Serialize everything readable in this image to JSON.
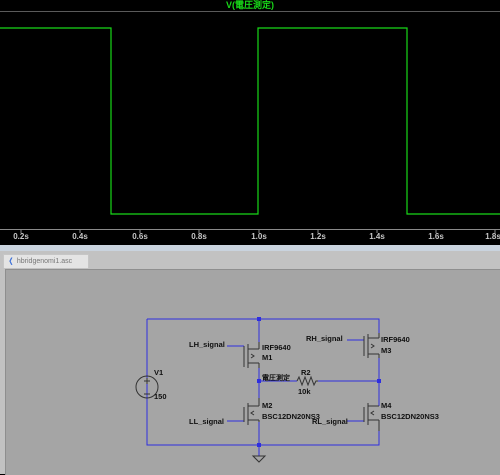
{
  "plot": {
    "trace_name": "V(電圧測定)",
    "trace_color": "#18d818",
    "background": "#000000",
    "x_ticks": [
      "0.2s",
      "0.4s",
      "0.6s",
      "0.8s",
      "1.0s",
      "1.2s",
      "1.4s",
      "1.6s",
      "1.8s"
    ]
  },
  "schematic": {
    "tab_title": "hbridgenomi1.asc",
    "wire_color": "#2e2ee0",
    "labels": {
      "lh_signal": "LH_signal",
      "ll_signal": "LL_signal",
      "rh_signal": "RH_signal",
      "rl_signal": "RL_signal",
      "m1_model": "IRF9640",
      "m1_name": "M1",
      "m2_model": "BSC12DN20NS3",
      "m2_name": "M2",
      "m3_model": "IRF9640",
      "m3_name": "M3",
      "m4_model": "BSC12DN20NS3",
      "m4_name": "M4",
      "v1_name": "V1",
      "v1_value": "150",
      "r2_name": "R2",
      "r2_value": "10k",
      "measure_net": "電圧測定"
    }
  }
}
